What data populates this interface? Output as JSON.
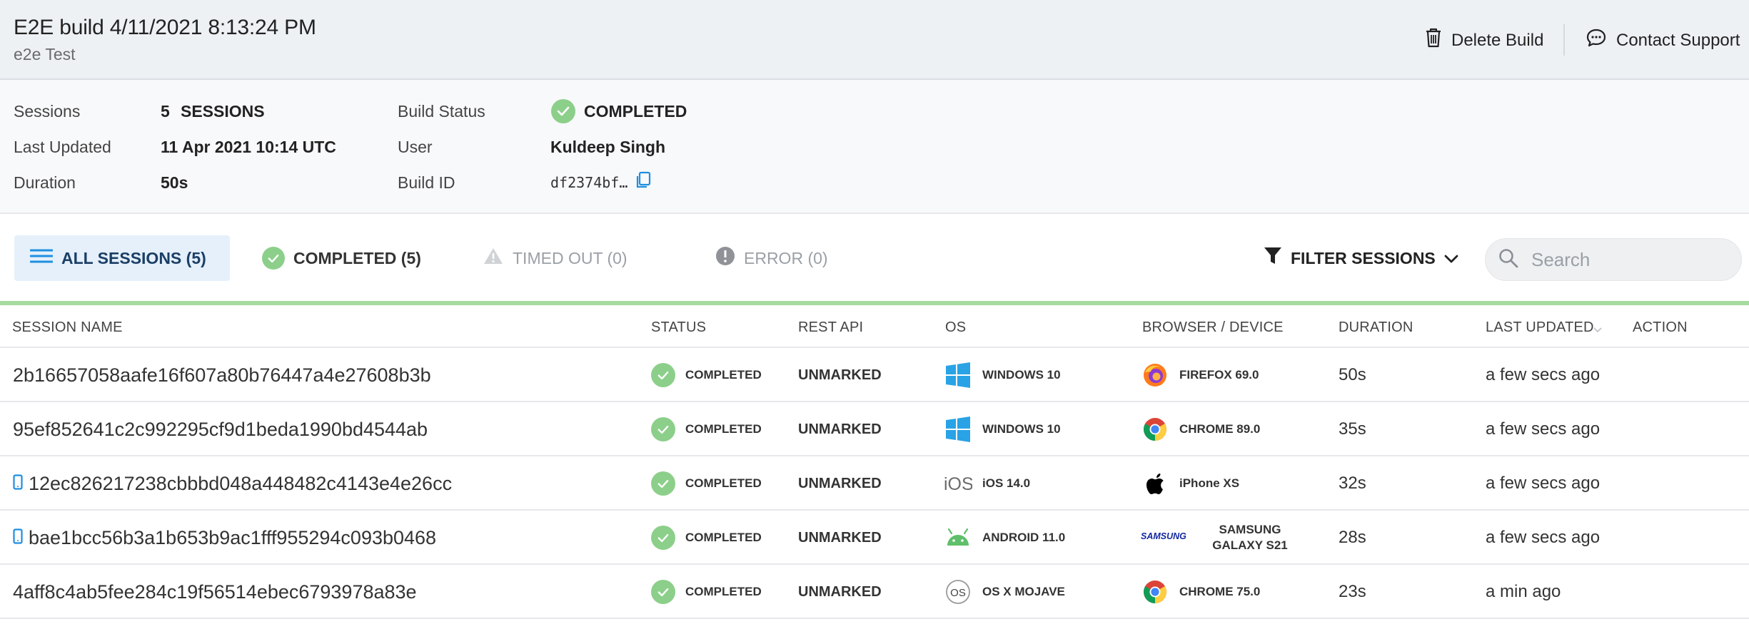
{
  "header": {
    "title": "E2E build 4/11/2021 8:13:24 PM",
    "subtitle": "e2e Test",
    "delete_label": "Delete Build",
    "support_label": "Contact Support"
  },
  "info": {
    "sessions_label": "Sessions",
    "sessions_count": "5",
    "sessions_unit": "SESSIONS",
    "last_updated_label": "Last Updated",
    "last_updated_value": "11 Apr 2021 10:14 UTC",
    "duration_label": "Duration",
    "duration_value": "50s",
    "build_status_label": "Build Status",
    "build_status_value": "COMPLETED",
    "user_label": "User",
    "user_value": "Kuldeep Singh",
    "build_id_label": "Build ID",
    "build_id_value": "df2374bf…"
  },
  "tabs": [
    {
      "label": "ALL SESSIONS (5)"
    },
    {
      "label": "COMPLETED (5)"
    },
    {
      "label": "TIMED OUT (0)"
    },
    {
      "label": "ERROR (0)"
    }
  ],
  "filter_label": "FILTER SESSIONS",
  "search": {
    "placeholder": "Search"
  },
  "columns": {
    "session_name": "SESSION NAME",
    "status": "STATUS",
    "rest_api": "REST API",
    "os": "OS",
    "browser": "BROWSER / DEVICE",
    "duration": "DURATION",
    "last_updated": "LAST UPDATED",
    "action": "ACTION"
  },
  "rows": [
    {
      "name": "2b16657058aafe16f607a80b76447a4e27608b3b",
      "mobile": false,
      "status": "COMPLETED",
      "rest": "UNMARKED",
      "os": "WINDOWS 10",
      "os_icon": "windows-icon",
      "browser": "FIREFOX 69.0",
      "browser_icon": "firefox-icon",
      "duration": "50s",
      "updated": "a few secs ago"
    },
    {
      "name": "95ef852641c2c992295cf9d1beda1990bd4544ab",
      "mobile": false,
      "status": "COMPLETED",
      "rest": "UNMARKED",
      "os": "WINDOWS 10",
      "os_icon": "windows-icon",
      "browser": "CHROME 89.0",
      "browser_icon": "chrome-icon",
      "duration": "35s",
      "updated": "a few secs ago"
    },
    {
      "name": "12ec826217238cbbbd048a448482c4143e4e26cc",
      "mobile": true,
      "status": "COMPLETED",
      "rest": "UNMARKED",
      "os": "iOS 14.0",
      "os_icon": "ios-icon",
      "browser": "iPhone XS",
      "browser_icon": "apple-icon",
      "duration": "32s",
      "updated": "a few secs ago"
    },
    {
      "name": "bae1bcc56b3a1b653b9ac1fff955294c093b0468",
      "mobile": true,
      "status": "COMPLETED",
      "rest": "UNMARKED",
      "os": "ANDROID 11.0",
      "os_icon": "android-icon",
      "browser": "SAMSUNG GALAXY S21",
      "browser_icon": "samsung-logo",
      "duration": "28s",
      "updated": "a few secs ago"
    },
    {
      "name": "4aff8c4ab5fee284c19f56514ebec6793978a83e",
      "mobile": false,
      "status": "COMPLETED",
      "rest": "UNMARKED",
      "os": "OS X MOJAVE",
      "os_icon": "macos-icon",
      "browser": "CHROME 75.0",
      "browser_icon": "chrome-icon",
      "duration": "23s",
      "updated": "a min ago"
    }
  ],
  "icon_labels": {
    "ios": "iOS",
    "macos": "OS",
    "samsung": "SAMSUNG"
  },
  "colors": {
    "completed_green": "#8ccf8a",
    "active_tab_bg": "#e5f0fb",
    "accent_blue": "#1f8fe0",
    "header_bg": "#eef1f4"
  }
}
